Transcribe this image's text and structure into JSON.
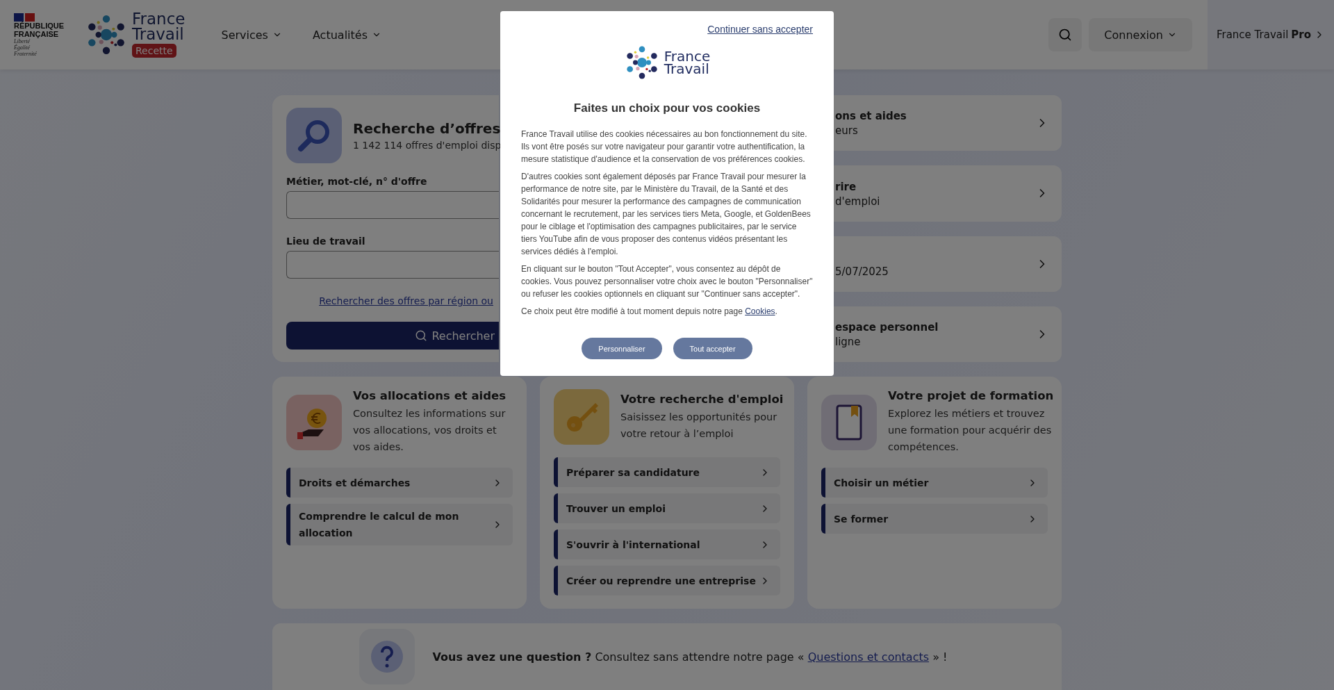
{
  "header": {
    "gov_logo": {
      "lines": [
        "RÉPUBLIQUE",
        "FRANÇAISE"
      ],
      "motto": [
        "Liberté",
        "Égalité",
        "Fraternité"
      ]
    },
    "brand": [
      "France",
      "Travail"
    ],
    "badge": "Recette",
    "nav": [
      {
        "label": "Services"
      },
      {
        "label": "Actualités"
      }
    ],
    "login": "Connexion",
    "pro": {
      "name": "France Travail",
      "suffix": "Pro"
    }
  },
  "search_card": {
    "title": "Recherche d’offres",
    "subtitle": "1 142 114 offres d'emploi disp",
    "fields": [
      {
        "label": "Métier, mot-clé, n° d'offre"
      },
      {
        "label": "Lieu de travail"
      }
    ],
    "link": "Rechercher des offres par région ou",
    "button": "Rechercher"
  },
  "side_cards": [
    {
      "title": "ons et aides",
      "subtitle": "eurs"
    },
    {
      "title": "rire",
      "subtitle": "d'emploi"
    },
    {
      "subtitle": "5/07/2025"
    },
    {
      "title": "espace personnel",
      "subtitle": "ligne"
    }
  ],
  "cards": [
    {
      "kind": "allocation",
      "title": "Vos allocations et aides",
      "text": "Consultez les informations sur vos allocations, vos droits et vos aides.",
      "links": [
        "Droits et démarches",
        "Comprendre le calcul de mon allocation"
      ]
    },
    {
      "kind": "job",
      "title": "Votre recherche d'emploi",
      "text": "Saisissez les opportunités pour votre retour à l’emploi",
      "links": [
        "Préparer sa candidature",
        "Trouver un emploi",
        "S'ouvrir à l'international",
        "Créer ou reprendre une entreprise"
      ]
    },
    {
      "kind": "training",
      "title": "Votre projet de formation",
      "text": "Explorez les métiers et trouvez une formation pour acquérir des compétences.",
      "links": [
        "Choisir un métier",
        "Se former"
      ]
    }
  ],
  "question": {
    "text": "**Vous avez une question ?** Consultez sans attendre notre page « ",
    "link": "Questions et contacts",
    "end": " » !"
  },
  "cookie_dialog": {
    "skip_link": "Continuer sans accepter",
    "brand": [
      "France",
      "Travail"
    ],
    "title": "Faites un choix pour vos cookies",
    "paragraphs": [
      "France Travail utilise des cookies nécessaires au bon fonctionnement du site. Ils vont être posés sur votre navigateur pour garantir votre authentification, la mesure statistique d'audience et la conservation de vos préférences cookies.",
      "D'autres cookies sont également déposés par France Travail pour mesurer la performance de notre site, par le Ministère du Travail, de la Santé et des Solidarités pour mesurer la performance des campagnes de communication concernant le recrutement, par les services tiers Meta, Google, et GoldenBees pour le ciblage et l'optimisation des campagnes publicitaires, par le service tiers YouTube afin de vous proposer des contenus vidéos présentant les services dédiés à l'emploi.",
      "En cliquant sur le bouton \"Tout Accepter\", vous consentez au dépôt de cookies. Vous pouvez personnaliser votre choix avec le bouton \"Personnaliser\" ou refuser les cookies optionnels en cliquant sur \"Continuer sans accepter\"."
    ],
    "last_paragraph": "Ce choix peut être modifié à tout moment depuis notre page ",
    "last_link": "Cookies",
    "last_end": ".",
    "buttons": [
      "Personnaliser",
      "Tout accepter"
    ]
  }
}
